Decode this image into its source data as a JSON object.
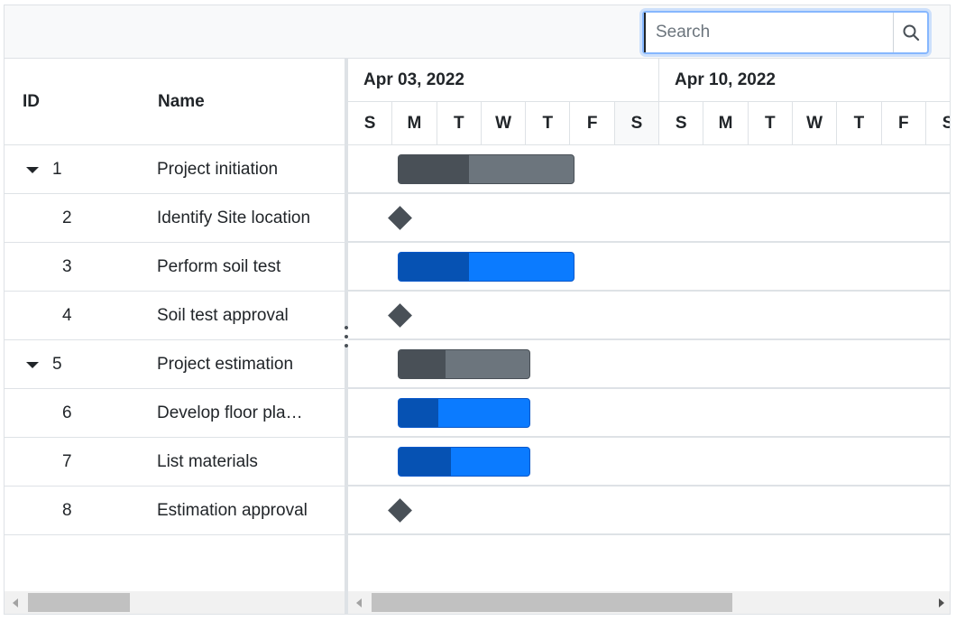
{
  "toolbar": {
    "search_placeholder": "Search",
    "search_icon": "search-icon"
  },
  "grid": {
    "columns": {
      "id": "ID",
      "name": "Name"
    },
    "rows": [
      {
        "id": "1",
        "name": "Project initiation",
        "expandable": true
      },
      {
        "id": "2",
        "name": "Identify Site location",
        "expandable": false
      },
      {
        "id": "3",
        "name": "Perform soil test",
        "expandable": false
      },
      {
        "id": "4",
        "name": "Soil test approval",
        "expandable": false
      },
      {
        "id": "5",
        "name": "Project estimation",
        "expandable": true
      },
      {
        "id": "6",
        "name": "Develop floor pla…",
        "expandable": false
      },
      {
        "id": "7",
        "name": "List materials",
        "expandable": false
      },
      {
        "id": "8",
        "name": "Estimation approval",
        "expandable": false
      }
    ]
  },
  "timeline": {
    "weeks": [
      "Apr 03, 2022",
      "Apr 10, 2022"
    ],
    "days": [
      "S",
      "M",
      "T",
      "W",
      "T",
      "F",
      "S",
      "S",
      "M",
      "T",
      "W",
      "T",
      "F",
      "S"
    ]
  },
  "tasks": [
    {
      "type": "parent",
      "start_day": 1,
      "duration_days": 4,
      "progress": 0.4
    },
    {
      "type": "milestone",
      "start_day": 1
    },
    {
      "type": "child",
      "start_day": 1,
      "duration_days": 4,
      "progress": 0.4
    },
    {
      "type": "milestone",
      "start_day": 1
    },
    {
      "type": "parent",
      "start_day": 1,
      "duration_days": 3,
      "progress": 0.36
    },
    {
      "type": "child",
      "start_day": 1,
      "duration_days": 3,
      "progress": 0.3
    },
    {
      "type": "child",
      "start_day": 1,
      "duration_days": 3,
      "progress": 0.4
    },
    {
      "type": "milestone",
      "start_day": 1
    }
  ],
  "colors": {
    "parent_bar": "#6c757d",
    "parent_progress": "#495057",
    "child_bar": "#0b7bff",
    "child_progress": "#0652b3",
    "milestone": "#495057",
    "focus_ring": "#86b7fe"
  },
  "scroll": {
    "grid_thumb_fraction": 0.3,
    "chart_thumb_fraction": 0.6
  }
}
